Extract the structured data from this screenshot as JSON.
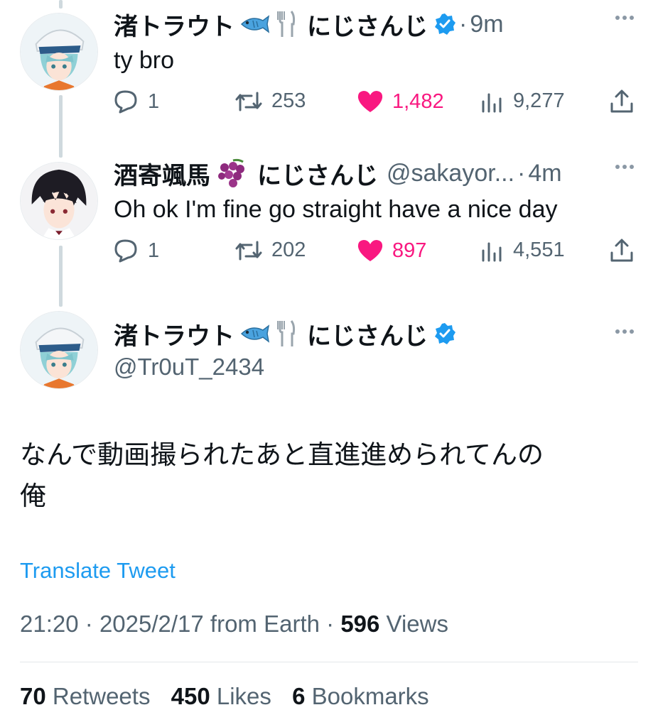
{
  "colors": {
    "accent": "#1d9bf0",
    "like": "#f91880",
    "muted": "#536471",
    "text": "#0f1419"
  },
  "tweets": [
    {
      "name": "渚トラウト",
      "emoji": [
        "fish-emoji",
        "fork-knife-emoji"
      ],
      "org": "にじさんじ",
      "verified": true,
      "handle": "",
      "dot": "·",
      "time": "9m",
      "text": "ty bro",
      "replies": "1",
      "retweets": "253",
      "likes": "1,482",
      "views": "9,277",
      "liked": true
    },
    {
      "name": "酒寄颯馬",
      "emoji": [
        "grapes-emoji"
      ],
      "org": "にじさんじ",
      "verified": false,
      "handle": "@sakayor...",
      "dot": "·",
      "time": "4m",
      "text": "Oh ok I'm fine go straight have a nice day",
      "replies": "1",
      "retweets": "202",
      "likes": "897",
      "views": "4,551",
      "liked": true
    }
  ],
  "main": {
    "name": "渚トラウト",
    "org": "にじさんじ",
    "handle": "@Tr0uT_2434",
    "text_line1": "なんで動画撮られたあと直進進められてんの",
    "text_line2": "俺",
    "translate": "Translate Tweet",
    "time": "21:20",
    "date": "2025/2/17",
    "source": "from Earth",
    "views_count": "596",
    "views_label": "Views",
    "dot": "·",
    "retweets_count": "70",
    "retweets_label": "Retweets",
    "likes_count": "450",
    "likes_label": "Likes",
    "bookmarks_count": "6",
    "bookmarks_label": "Bookmarks"
  }
}
